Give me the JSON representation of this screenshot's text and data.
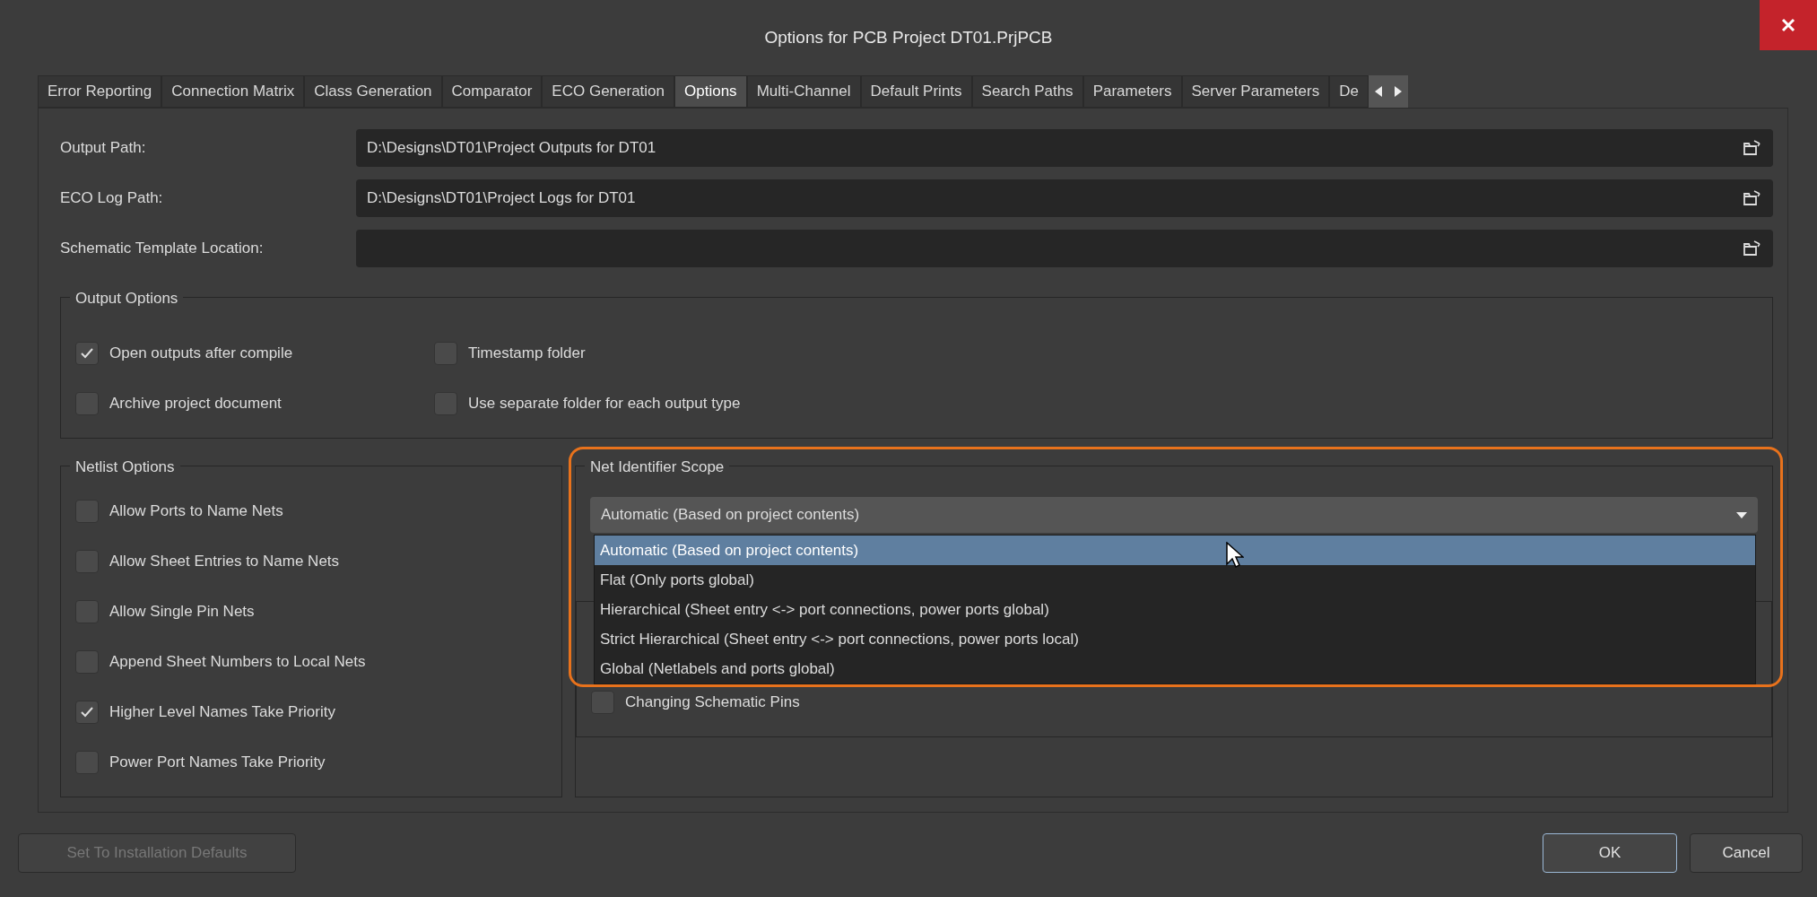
{
  "window": {
    "title": "Options for PCB Project DT01.PrjPCB"
  },
  "tabs": [
    {
      "label": "Error Reporting",
      "selected": false
    },
    {
      "label": "Connection Matrix",
      "selected": false
    },
    {
      "label": "Class Generation",
      "selected": false
    },
    {
      "label": "Comparator",
      "selected": false
    },
    {
      "label": "ECO Generation",
      "selected": false
    },
    {
      "label": "Options",
      "selected": true
    },
    {
      "label": "Multi-Channel",
      "selected": false
    },
    {
      "label": "Default Prints",
      "selected": false
    },
    {
      "label": "Search Paths",
      "selected": false
    },
    {
      "label": "Parameters",
      "selected": false
    },
    {
      "label": "Server Parameters",
      "selected": false
    },
    {
      "label": "De",
      "selected": false
    }
  ],
  "paths": [
    {
      "label": "Output Path:",
      "value": "D:\\Designs\\DT01\\Project Outputs for DT01"
    },
    {
      "label": "ECO Log Path:",
      "value": "D:\\Designs\\DT01\\Project Logs for DT01"
    },
    {
      "label": "Schematic Template Location:"
    }
  ],
  "output_options": {
    "title": "Output Options",
    "items": [
      {
        "label": "Open outputs after compile",
        "checked": true
      },
      {
        "label": "Timestamp folder",
        "checked": false
      },
      {
        "label": "Archive project document",
        "checked": false
      },
      {
        "label": "Use separate folder for each output type",
        "checked": false
      }
    ]
  },
  "netlist_options": {
    "title": "Netlist Options",
    "items": [
      {
        "label": "Allow Ports to Name Nets",
        "checked": false
      },
      {
        "label": "Allow Sheet Entries to Name Nets",
        "checked": false
      },
      {
        "label": "Allow Single Pin Nets",
        "checked": false
      },
      {
        "label": "Append Sheet Numbers to Local Nets",
        "checked": false
      },
      {
        "label": "Higher Level Names Take Priority",
        "checked": true
      },
      {
        "label": "Power Port Names Take Priority",
        "checked": false
      }
    ]
  },
  "net_identifier_scope": {
    "title": "Net Identifier Scope",
    "dropdown": {
      "value": "Automatic (Based on project contents)",
      "expanded": true,
      "options": [
        {
          "label": "Automatic (Based on project contents)",
          "selected": true
        },
        {
          "label": "Flat (Only ports global)",
          "selected": false
        },
        {
          "label": "Hierarchical (Sheet entry <-> port connections, power ports global)",
          "selected": false
        },
        {
          "label": "Strict Hierarchical (Sheet entry <-> port connections, power ports local)",
          "selected": false
        },
        {
          "label": "Global (Netlabels and ports global)",
          "selected": false
        }
      ]
    }
  },
  "covered_group": {
    "items": [
      {
        "label": "Changing Schematic Pins",
        "checked": false
      }
    ]
  },
  "buttons": [
    {
      "label": "Set To Installation Defaults",
      "disabled": true,
      "default": false
    },
    {
      "label": "OK",
      "disabled": false,
      "default": true
    },
    {
      "label": "Cancel",
      "disabled": false,
      "default": false
    }
  ]
}
